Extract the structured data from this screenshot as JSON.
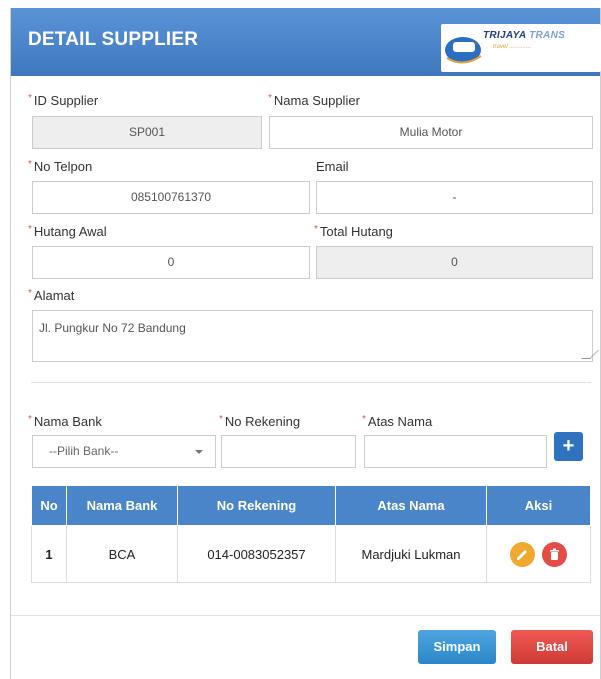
{
  "header": {
    "title": "DETAIL SUPPLIER",
    "logo_text": "TRIJAYA",
    "logo_text_2": "TRANS",
    "logo_sub": "travel ............."
  },
  "form": {
    "id_supplier": {
      "label": "ID Supplier",
      "value": "SP001"
    },
    "nama_supplier": {
      "label": "Nama Supplier",
      "value": "Mulia Motor"
    },
    "no_telpon": {
      "label": "No Telpon",
      "value": "085100761370"
    },
    "email": {
      "label": "Email",
      "value": "-"
    },
    "hutang_awal": {
      "label": "Hutang Awal",
      "value": "0"
    },
    "total_hutang": {
      "label": "Total Hutang",
      "value": "0"
    },
    "alamat": {
      "label": "Alamat",
      "value": "Jl. Pungkur No 72 Bandung"
    },
    "required_mark": "*"
  },
  "bank_form": {
    "nama_bank": {
      "label": "Nama Bank",
      "placeholder": "--Pilih Bank--"
    },
    "no_rekening": {
      "label": "No Rekening",
      "value": ""
    },
    "atas_nama": {
      "label": "Atas Nama",
      "value": ""
    },
    "add_label": "+"
  },
  "table": {
    "headers": [
      "No",
      "Nama Bank",
      "No Rekening",
      "Atas Nama",
      "Aksi"
    ],
    "rows": [
      {
        "no": "1",
        "nama_bank": "BCA",
        "no_rekening": "014-0083052357",
        "atas_nama": "Mardjuki Lukman"
      }
    ]
  },
  "footer": {
    "save_label": "Simpan",
    "cancel_label": "Batal"
  },
  "colors": {
    "header": "#4a84c9",
    "save": "#2b86c8",
    "cancel": "#e44c45",
    "edit": "#f0a830"
  }
}
